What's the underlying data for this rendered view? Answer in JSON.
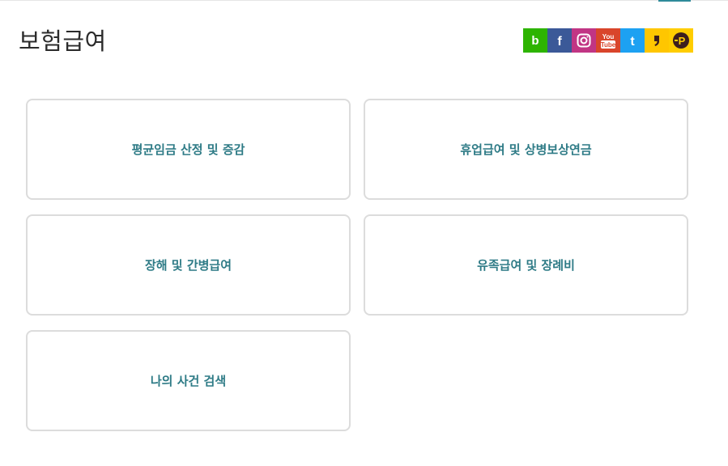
{
  "page": {
    "title": "보험급여"
  },
  "sns": [
    {
      "name": "blog",
      "glyph": "b",
      "color": "#2db400"
    },
    {
      "name": "facebook",
      "glyph": "f",
      "color": "#3b5998"
    },
    {
      "name": "instagram",
      "glyph": "",
      "color": "#c13584"
    },
    {
      "name": "youtube",
      "glyph": "You Tube",
      "color": "#d9452b"
    },
    {
      "name": "twitter",
      "glyph": "t",
      "color": "#1da1f2"
    },
    {
      "name": "kakaostory",
      "glyph": "",
      "color": "#ffc600"
    },
    {
      "name": "kakao-plus",
      "glyph": "P",
      "color": "#ffcd00"
    }
  ],
  "cards": [
    {
      "label": "평균임금 산정 및 증감"
    },
    {
      "label": "휴업급여 및 상병보상연금"
    },
    {
      "label": "장해 및 간병급여"
    },
    {
      "label": "유족급여 및 장례비"
    },
    {
      "label": "나의 사건 검색"
    }
  ]
}
